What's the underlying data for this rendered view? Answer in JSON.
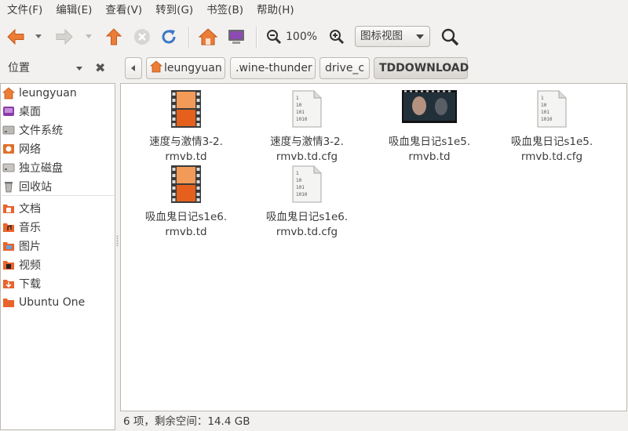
{
  "menubar": {
    "items": [
      "文件(F)",
      "编辑(E)",
      "查看(V)",
      "转到(G)",
      "书签(B)",
      "帮助(H)"
    ]
  },
  "toolbar": {
    "back": "back-arrow-icon",
    "forward": "forward-arrow-icon",
    "up": "up-arrow-icon",
    "stop": "stop-icon",
    "reload": "reload-icon",
    "home": "home-icon",
    "computer": "computer-icon",
    "zoom_level": "100%",
    "view_mode": "图标视图",
    "search": "search-icon"
  },
  "location": {
    "places_label": "位置",
    "close_glyph": "✖",
    "crumbs": [
      "leungyuan",
      ".wine-thunder",
      "drive_c",
      "TDDOWNLOAD"
    ]
  },
  "sidebar": {
    "items": [
      {
        "label": "leungyuan",
        "icon": "home-folder-icon"
      },
      {
        "label": "桌面",
        "icon": "desktop-icon"
      },
      {
        "label": "文件系统",
        "icon": "filesystem-icon"
      },
      {
        "label": "网络",
        "icon": "network-icon"
      },
      {
        "label": "独立磁盘",
        "icon": "disk-icon"
      },
      {
        "label": "回收站",
        "icon": "trash-icon"
      },
      {
        "label": "文档",
        "icon": "documents-folder-icon"
      },
      {
        "label": "音乐",
        "icon": "music-folder-icon"
      },
      {
        "label": "图片",
        "icon": "pictures-folder-icon"
      },
      {
        "label": "视频",
        "icon": "videos-folder-icon"
      },
      {
        "label": "下载",
        "icon": "downloads-folder-icon"
      },
      {
        "label": "Ubuntu One",
        "icon": "ubuntu-one-folder-icon"
      }
    ]
  },
  "files": [
    {
      "line1": "速度与激情3-2.",
      "line2": "rmvb.td",
      "icon": "video-file-icon"
    },
    {
      "line1": "速度与激情3-2.",
      "line2": "rmvb.td.cfg",
      "icon": "binary-file-icon"
    },
    {
      "line1": "吸血鬼日记s1e5.",
      "line2": "rmvb.td",
      "icon": "video-thumbnail-icon"
    },
    {
      "line1": "吸血鬼日记s1e5.",
      "line2": "rmvb.td.cfg",
      "icon": "binary-file-icon"
    },
    {
      "line1": "吸血鬼日记s1e6.",
      "line2": "rmvb.td",
      "icon": "video-file-icon"
    },
    {
      "line1": "吸血鬼日记s1e6.",
      "line2": "rmvb.td.cfg",
      "icon": "binary-file-icon"
    }
  ],
  "status": "6 项，剩余空间：14.4 GB",
  "colors": {
    "accent_orange": "#e9632c",
    "window_bg": "#f2f1f0",
    "toolbar_blue": "#3b78c6"
  }
}
